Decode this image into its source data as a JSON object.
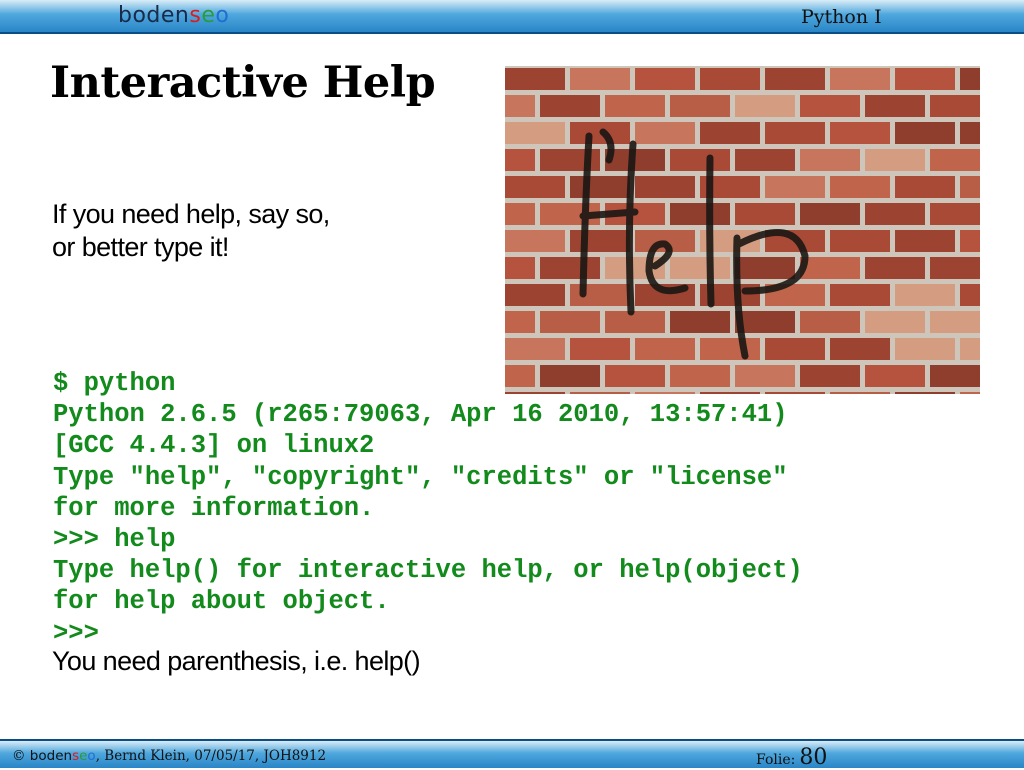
{
  "header": {
    "logo": {
      "part1": "boden",
      "s": "s",
      "e": "e",
      "o": "o"
    },
    "course": "Python I"
  },
  "slide": {
    "title": "Interactive Help",
    "intro_lines": [
      "If you need help, say so,",
      "or better type it!"
    ],
    "image_graffiti": "Help",
    "code_lines": [
      "$ python",
      "Python 2.6.5 (r265:79063, Apr 16 2010, 13:57:41)",
      "[GCC 4.4.3] on linux2",
      "Type \"help\", \"copyright\", \"credits\" or \"license\"",
      "for more information.",
      ">>> help",
      "Type help() for interactive help, or help(object)",
      "for help about object.",
      ">>>"
    ],
    "note": "You need parenthesis, i.e. help()"
  },
  "footer": {
    "copyright": "©",
    "author_date": ", Bernd Klein, 07/05/17, JOH8912",
    "folie_label": "Folie:",
    "folie_number": "80"
  },
  "colors": {
    "code": "#128a1c",
    "bar": "#2a85c7",
    "brick": "#b5533e",
    "mortar": "#cfc6bb"
  }
}
